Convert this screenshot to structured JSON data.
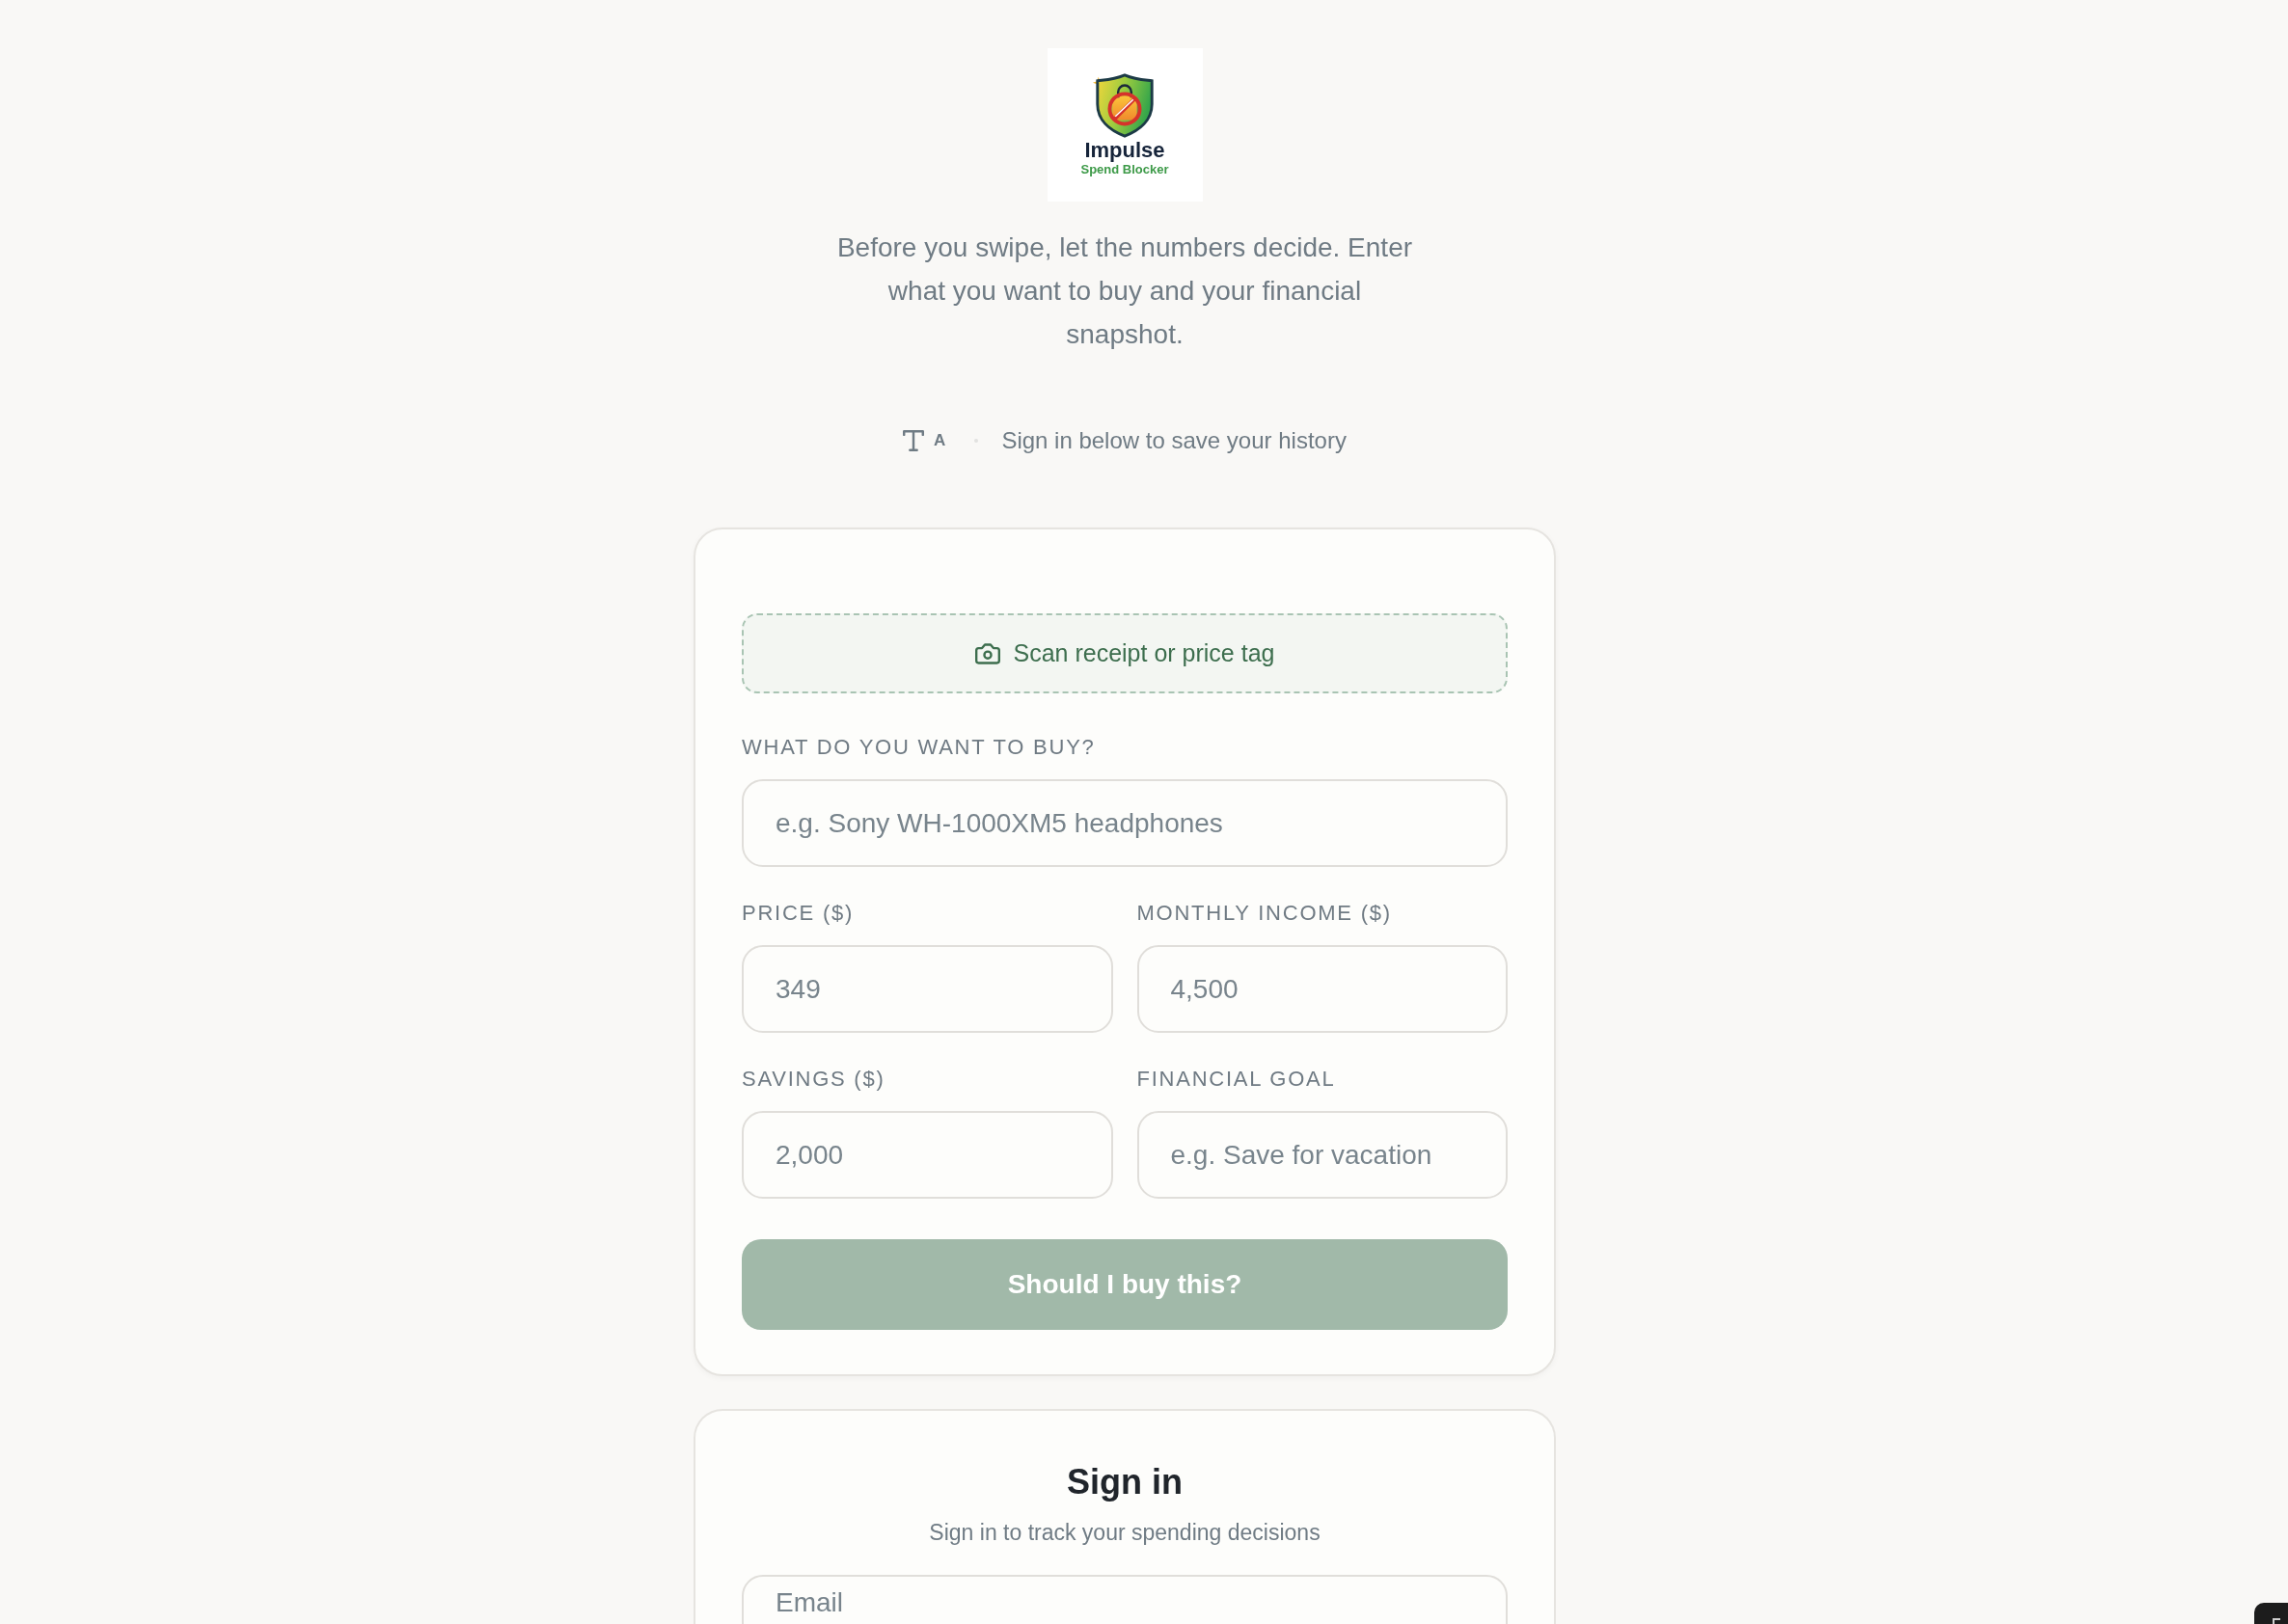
{
  "logo": {
    "title": "Impulse",
    "subtitle": "Spend Blocker"
  },
  "tagline": "Before you swipe, let the numbers decide. Enter what you want to buy and your financial snapshot.",
  "toolbar": {
    "font_size_label": "A",
    "status": "Sign in below to save your history"
  },
  "purchase_form": {
    "scan_button": "Scan receipt or price tag",
    "item_field": {
      "label": "WHAT DO YOU WANT TO BUY?",
      "placeholder": "e.g. Sony WH-1000XM5 headphones"
    },
    "detail_fields": [
      {
        "label": "PRICE ($)",
        "placeholder": "349"
      },
      {
        "label": "MONTHLY INCOME ($)",
        "placeholder": "4,500"
      },
      {
        "label": "SAVINGS ($)",
        "placeholder": "2,000"
      },
      {
        "label": "FINANCIAL GOAL",
        "placeholder": "e.g. Save for vacation"
      }
    ],
    "submit_button": {
      "label": "Should I buy this?",
      "disabled": true
    }
  },
  "sign_in": {
    "title": "Sign in",
    "subtitle": "Sign in to track your spending decisions",
    "email_field": {
      "placeholder": "Email"
    }
  }
}
